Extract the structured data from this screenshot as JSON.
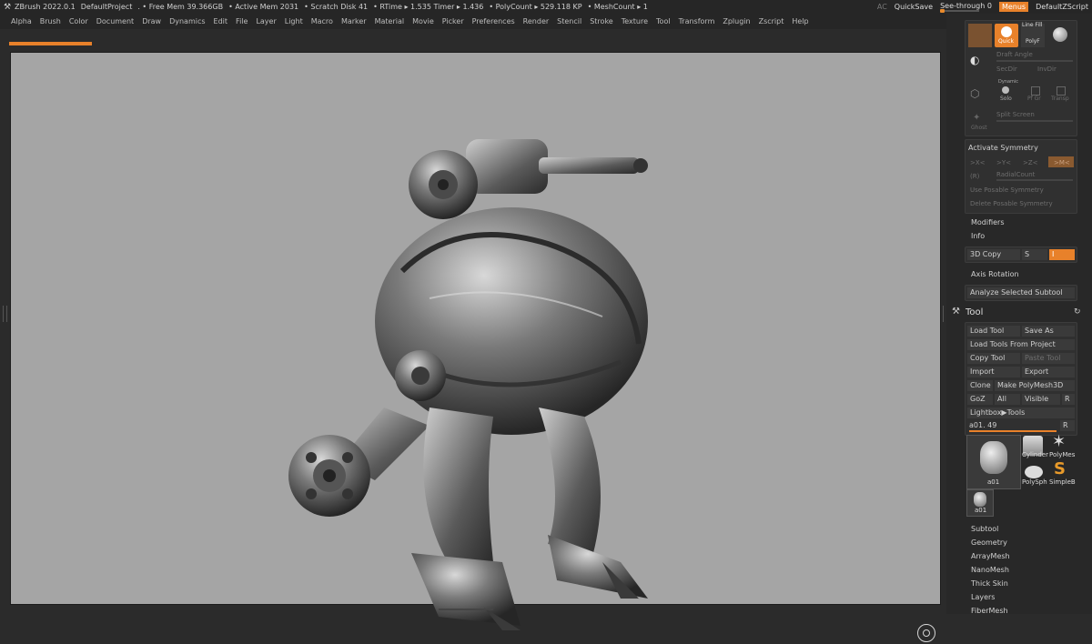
{
  "status_bar": {
    "app": "ZBrush 2022.0.1",
    "project": "DefaultProject",
    "free_mem": ". • Free Mem 39.366GB",
    "active_mem": "• Active Mem 2031",
    "scratch_disk": "• Scratch Disk 41",
    "rtime": "• RTime ▸ 1.535 Timer ▸ 1.436",
    "polycount": "• PolyCount ▸ 529.118 KP",
    "meshcount": "• MeshCount ▸ 1",
    "ac": "AC",
    "quicksave": "QuickSave",
    "see_through": "See-through  0",
    "see_through_value": 0,
    "menus": "Menus",
    "default_zscript": "DefaultZScript"
  },
  "menu_items": [
    "Alpha",
    "Brush",
    "Color",
    "Document",
    "Draw",
    "Dynamics",
    "Edit",
    "File",
    "Layer",
    "Light",
    "Macro",
    "Marker",
    "Material",
    "Movie",
    "Picker",
    "Preferences",
    "Render",
    "Stencil",
    "Stroke",
    "Texture",
    "Tool",
    "Transform",
    "Zplugin",
    "Zscript",
    "Help"
  ],
  "right_panel": {
    "top": {
      "quick": "Quick",
      "line_fill": "Line Fill",
      "polyf": "PolyF",
      "draft_angle": "Draft Angle",
      "sec_dir": "SecDir",
      "inv_dir": "InvDir",
      "dynamic": "Dynamic",
      "solo": "Solo",
      "pf_gr": "Pf Gr",
      "transp": "Transp",
      "ghost": "Ghost",
      "split_screen": "Split Screen"
    },
    "symmetry": {
      "activate": "Activate Symmetry",
      "x": ">X<",
      "y": ">Y<",
      "z": ">Z<",
      "m": ">M<",
      "r": "(R)",
      "radial_count": "RadialCount",
      "use_posable": "Use Posable Symmetry",
      "delete_posable": "Delete Posable Symmetry"
    },
    "modifiers": "Modifiers",
    "info": "Info",
    "copy_3d": "3D Copy",
    "s": "S",
    "i": "I",
    "axis_rotation": "Axis Rotation",
    "analyze": "Analyze Selected Subtool",
    "tool": {
      "title": "Tool",
      "load_tool": "Load Tool",
      "save_as": "Save As",
      "load_from_project": "Load Tools From Project",
      "copy_tool": "Copy Tool",
      "paste_tool": "Paste Tool",
      "import": "Import",
      "export": "Export",
      "clone": "Clone",
      "make_polymesh": "Make PolyMesh3D",
      "goz": "GoZ",
      "all": "All",
      "visible": "Visible",
      "r": "R",
      "lightbox": "Lightbox▶Tools",
      "current": "a01. 49",
      "slider_r": "R",
      "thumbs": {
        "a01": "a01",
        "cylinder": "Cylinder",
        "polymesh": "PolyMes",
        "polysph": "PolySph",
        "simpleb": "SimpleB",
        "a01_small": "a01"
      }
    },
    "sections": [
      "Subtool",
      "Geometry",
      "ArrayMesh",
      "NanoMesh",
      "Thick Skin",
      "Layers",
      "FiberMesh"
    ]
  },
  "colors": {
    "accent": "#e8812a",
    "canvas": "#a5a5a5",
    "panel": "#282828"
  }
}
